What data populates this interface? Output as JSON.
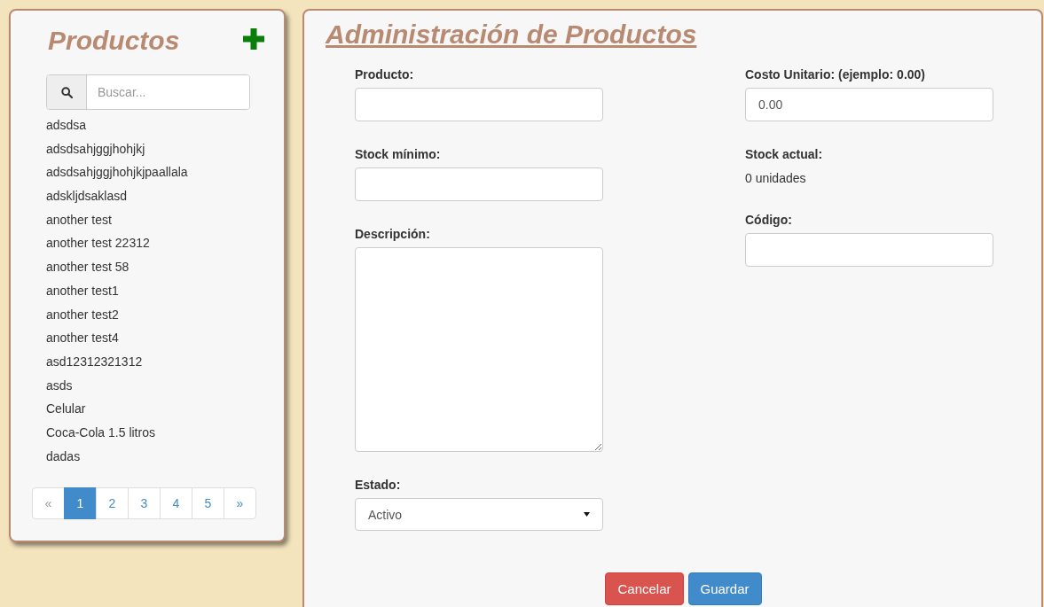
{
  "sidebar": {
    "title": "Productos",
    "search": {
      "placeholder": "Buscar..."
    },
    "items": [
      "adsdsa",
      "adsdsahjggjhohjkj",
      "adsdsahjggjhohjkjpaallala",
      "adskljdsaklasd",
      "another test",
      "another test 22312",
      "another test 58",
      "another test1",
      "another test2",
      "another test4",
      "asd12312321312",
      "asds",
      "Celular",
      "Coca-Cola 1.5 litros",
      "dadas"
    ],
    "pagination": [
      {
        "label": "«",
        "selected": false,
        "disabled": true
      },
      {
        "label": "1",
        "selected": true,
        "disabled": false
      },
      {
        "label": "2",
        "selected": false,
        "disabled": false
      },
      {
        "label": "3",
        "selected": false,
        "disabled": false
      },
      {
        "label": "4",
        "selected": false,
        "disabled": false
      },
      {
        "label": "5",
        "selected": false,
        "disabled": false
      },
      {
        "label": "»",
        "selected": false,
        "disabled": false
      }
    ]
  },
  "main": {
    "title": "Administración de Productos",
    "left_fields": [
      {
        "label": "Producto:",
        "kind": "input"
      },
      {
        "label": "Stock mínimo:",
        "kind": "input"
      },
      {
        "label": "Descripción:",
        "kind": "textarea"
      },
      {
        "label": "Estado:",
        "kind": "select",
        "value": "Activo"
      }
    ],
    "right_fields": [
      {
        "label": "Costo Unitario: (ejemplo: 0.00)",
        "kind": "input",
        "value": "0.00"
      },
      {
        "label": "Stock actual:",
        "kind": "text",
        "value": "0 unidades"
      },
      {
        "label": "Código:",
        "kind": "input"
      }
    ],
    "buttons": [
      {
        "label": "Cancelar",
        "kind": "danger"
      },
      {
        "label": "Guardar",
        "kind": "primary"
      }
    ]
  }
}
